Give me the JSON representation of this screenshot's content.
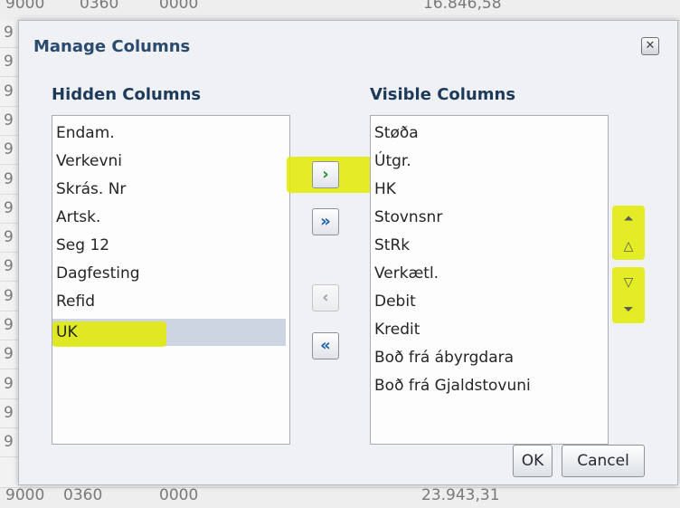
{
  "background_table": {
    "top_cells": [
      "9000",
      "0360",
      "0000",
      "16.846,58"
    ],
    "bottom_cells": [
      "9000",
      "0360",
      "0000",
      "23.943,31"
    ],
    "row_digits": [
      "9",
      "9",
      "9",
      "9",
      "9",
      "9",
      "9",
      "9",
      "9",
      "9",
      "9",
      "9",
      "9",
      "9",
      "9"
    ]
  },
  "dialog": {
    "title": "Manage Columns",
    "close_icon": "close-icon",
    "hidden_heading": "Hidden Columns",
    "visible_heading": "Visible Columns",
    "hidden_columns": [
      "Endam.",
      "Verkevni",
      "Skrás. Nr",
      "Artsk.",
      "Seg 12",
      "Dagfesting",
      "Refid",
      "UK"
    ],
    "hidden_selected_index": 7,
    "visible_columns": [
      "Støða",
      "Útgr.",
      "HK",
      "Stovnsnr",
      "StRk",
      "Verkætl.",
      "Debit",
      "Kredit",
      "Boð frá ábyrgdara",
      "Boð frá Gjaldstovuni"
    ],
    "move_buttons": {
      "move_right": "›",
      "move_all_right": "»",
      "move_left": "‹",
      "move_all_left": "«"
    },
    "order_buttons": {
      "top": "⏶",
      "up": "△",
      "down": "▽",
      "bottom": "⏷"
    },
    "ok_label": "OK",
    "cancel_label": "Cancel"
  },
  "colors": {
    "highlight": "#e2eb00",
    "title": "#2a4a6e",
    "selection": "#cdd4e2"
  }
}
